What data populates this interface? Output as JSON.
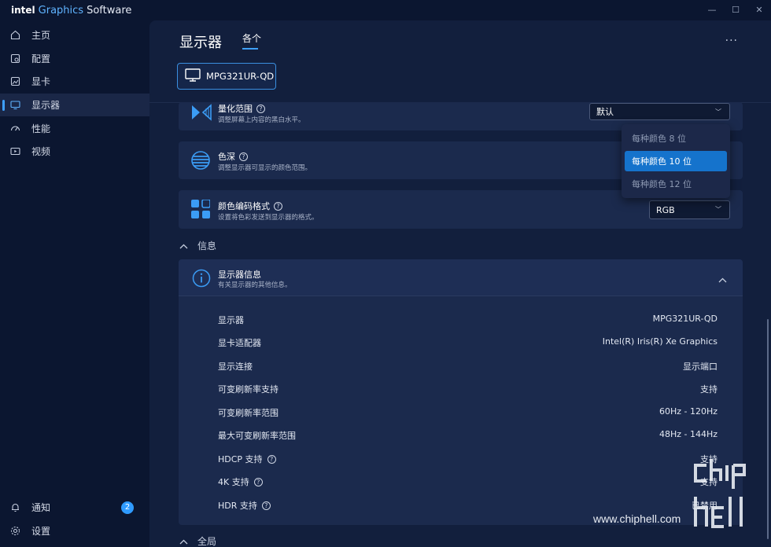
{
  "app": {
    "brand_intel": "intel",
    "brand_g": "Graphics",
    "brand_rest": "Software"
  },
  "window_controls": [
    "—",
    "☐",
    "✕"
  ],
  "sidebar": {
    "items": [
      {
        "label": "主页",
        "icon": "home-icon"
      },
      {
        "label": "配置",
        "icon": "profile-icon"
      },
      {
        "label": "显卡",
        "icon": "graphics-icon"
      },
      {
        "label": "显示器",
        "icon": "monitor-icon",
        "active": true
      },
      {
        "label": "性能",
        "icon": "gauge-icon"
      },
      {
        "label": "视频",
        "icon": "video-icon"
      }
    ],
    "bottom": [
      {
        "label": "通知",
        "icon": "bell-icon",
        "badge": "2"
      },
      {
        "label": "设置",
        "icon": "gear-icon"
      }
    ]
  },
  "header": {
    "title": "显示器",
    "tab": "各个",
    "more": "···"
  },
  "monitor": {
    "name": "MPG321UR-QD"
  },
  "settings": {
    "quant": {
      "title": "量化范围",
      "desc": "调整屏幕上内容的黑白水平。",
      "value": "默认"
    },
    "depth": {
      "title": "色深",
      "desc": "调整显示器可显示的颜色范围。"
    },
    "encoding": {
      "title": "颜色编码格式",
      "desc": "设置将色彩发送到显示器的格式。",
      "value": "RGB"
    }
  },
  "dropdown": {
    "options": [
      "每种颜色 8 位",
      "每种颜色 10 位",
      "每种颜色 12 位"
    ],
    "selected_index": 1
  },
  "info_section": {
    "heading": "信息",
    "card_title": "显示器信息",
    "card_desc": "有关显示器的其他信息。",
    "rows": [
      {
        "label": "显示器",
        "value": "MPG321UR-QD",
        "help": false
      },
      {
        "label": "显卡适配器",
        "value": "Intel(R) Iris(R) Xe Graphics",
        "help": false
      },
      {
        "label": "显示连接",
        "value": "显示端口",
        "help": false
      },
      {
        "label": "可变刷新率支持",
        "value": "支持",
        "help": false
      },
      {
        "label": "可变刷新率范围",
        "value": "60Hz - 120Hz",
        "help": false
      },
      {
        "label": "最大可变刷新率范围",
        "value": "48Hz - 144Hz",
        "help": false
      },
      {
        "label": "HDCP 支持",
        "value": "支持",
        "help": true
      },
      {
        "label": "4K 支持",
        "value": "支持",
        "help": true
      },
      {
        "label": "HDR 支持",
        "value": "已禁用",
        "help": true
      }
    ]
  },
  "global_section": {
    "heading": "全局"
  },
  "watermark": {
    "text": "www.chiphell.com"
  },
  "colors": {
    "accent": "#3ea0ff",
    "selected": "#1573cc",
    "card": "#1b2a4d",
    "background": "#0b1630"
  }
}
